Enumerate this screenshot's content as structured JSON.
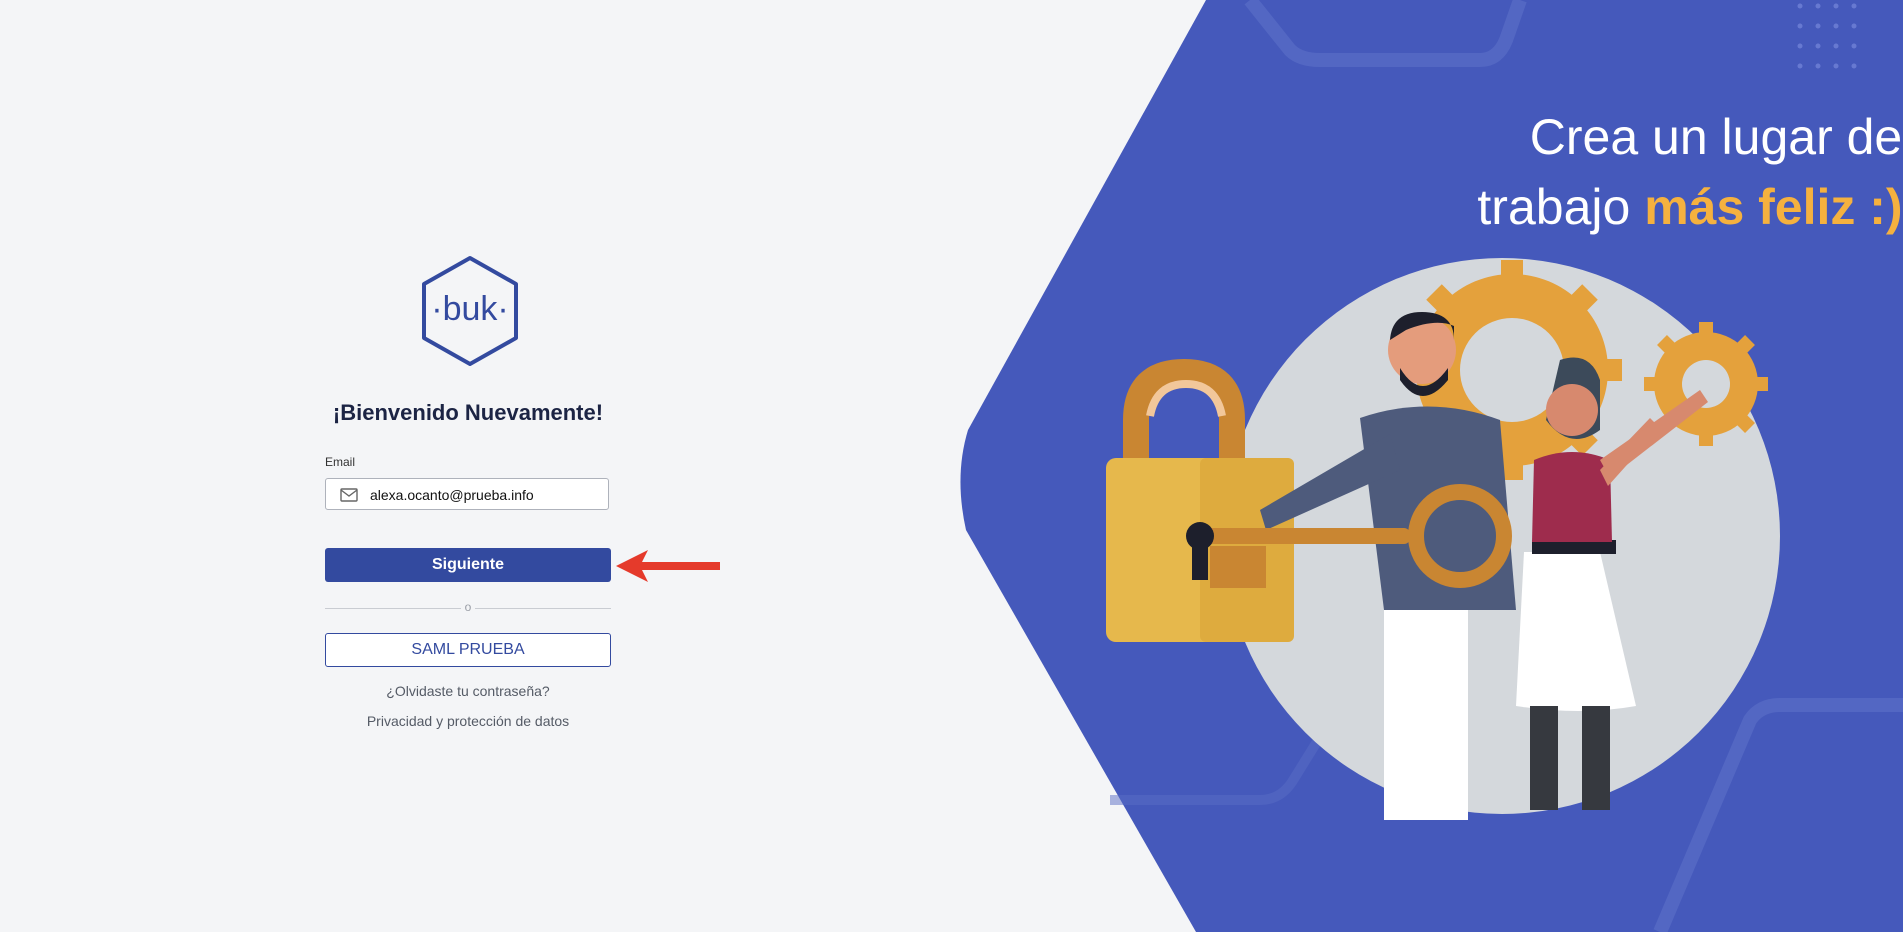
{
  "login": {
    "logo_text": "·buk·",
    "welcome": "¡Bienvenido Nuevamente!",
    "email_label": "Email",
    "email_value": "alexa.ocanto@prueba.info",
    "next_button": "Siguiente",
    "divider_text": "o",
    "saml_button": "SAML PRUEBA",
    "forgot_link": "¿Olvidaste tu contraseña?",
    "privacy_link": "Privacidad y protección de datos"
  },
  "hero": {
    "line1": "Crea un lugar de",
    "line2_prefix": "trabajo ",
    "line2_accent": "más feliz :)"
  },
  "colors": {
    "primary": "#334a9f",
    "hero_background": "#4559bb",
    "accent": "#f5b13f",
    "arrow": "#e53a2b"
  },
  "icons": [
    "mail-icon",
    "arrow-annotation"
  ]
}
